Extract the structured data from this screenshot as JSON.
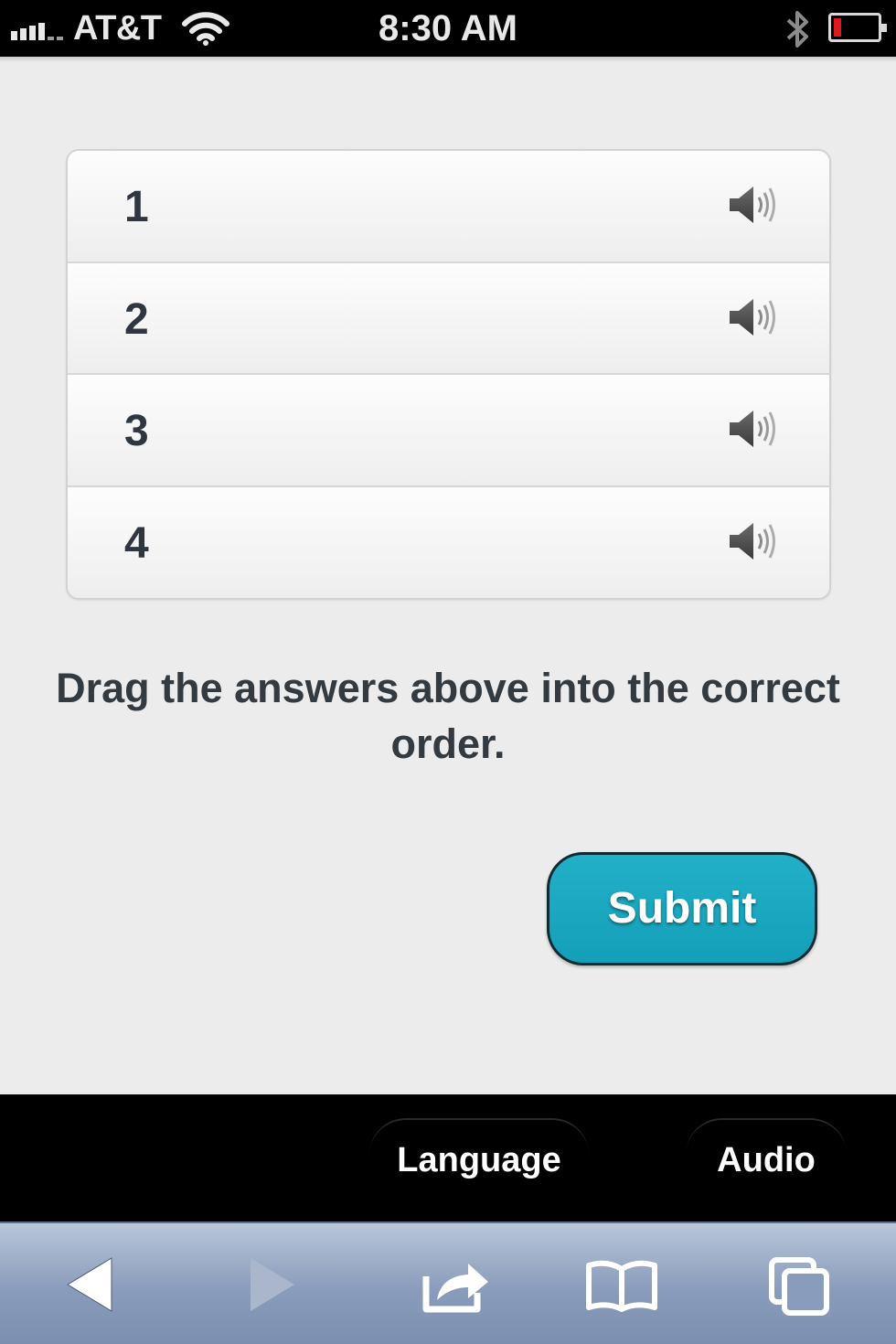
{
  "status_bar": {
    "carrier": "AT&T",
    "time": "8:30 AM",
    "icons": [
      "signal-icon",
      "wifi-icon",
      "bluetooth-icon",
      "battery-icon"
    ],
    "battery_level": 0.1
  },
  "answers": [
    {
      "label": "1",
      "icon": "speaker-icon"
    },
    {
      "label": "2",
      "icon": "speaker-icon"
    },
    {
      "label": "3",
      "icon": "speaker-icon"
    },
    {
      "label": "4",
      "icon": "speaker-icon"
    }
  ],
  "instructions": "Drag the answers above into the correct order.",
  "submit_label": "Submit",
  "app_bar": {
    "tabs": [
      {
        "label": "Language"
      },
      {
        "label": "Audio"
      }
    ]
  },
  "browser_toolbar": {
    "icons": [
      "back-icon",
      "forward-icon",
      "share-icon",
      "bookmarks-icon",
      "tabs-icon"
    ]
  },
  "colors": {
    "accent": "#1aa7bf",
    "background": "#ececec",
    "toolbar": "#8a9cbb"
  }
}
